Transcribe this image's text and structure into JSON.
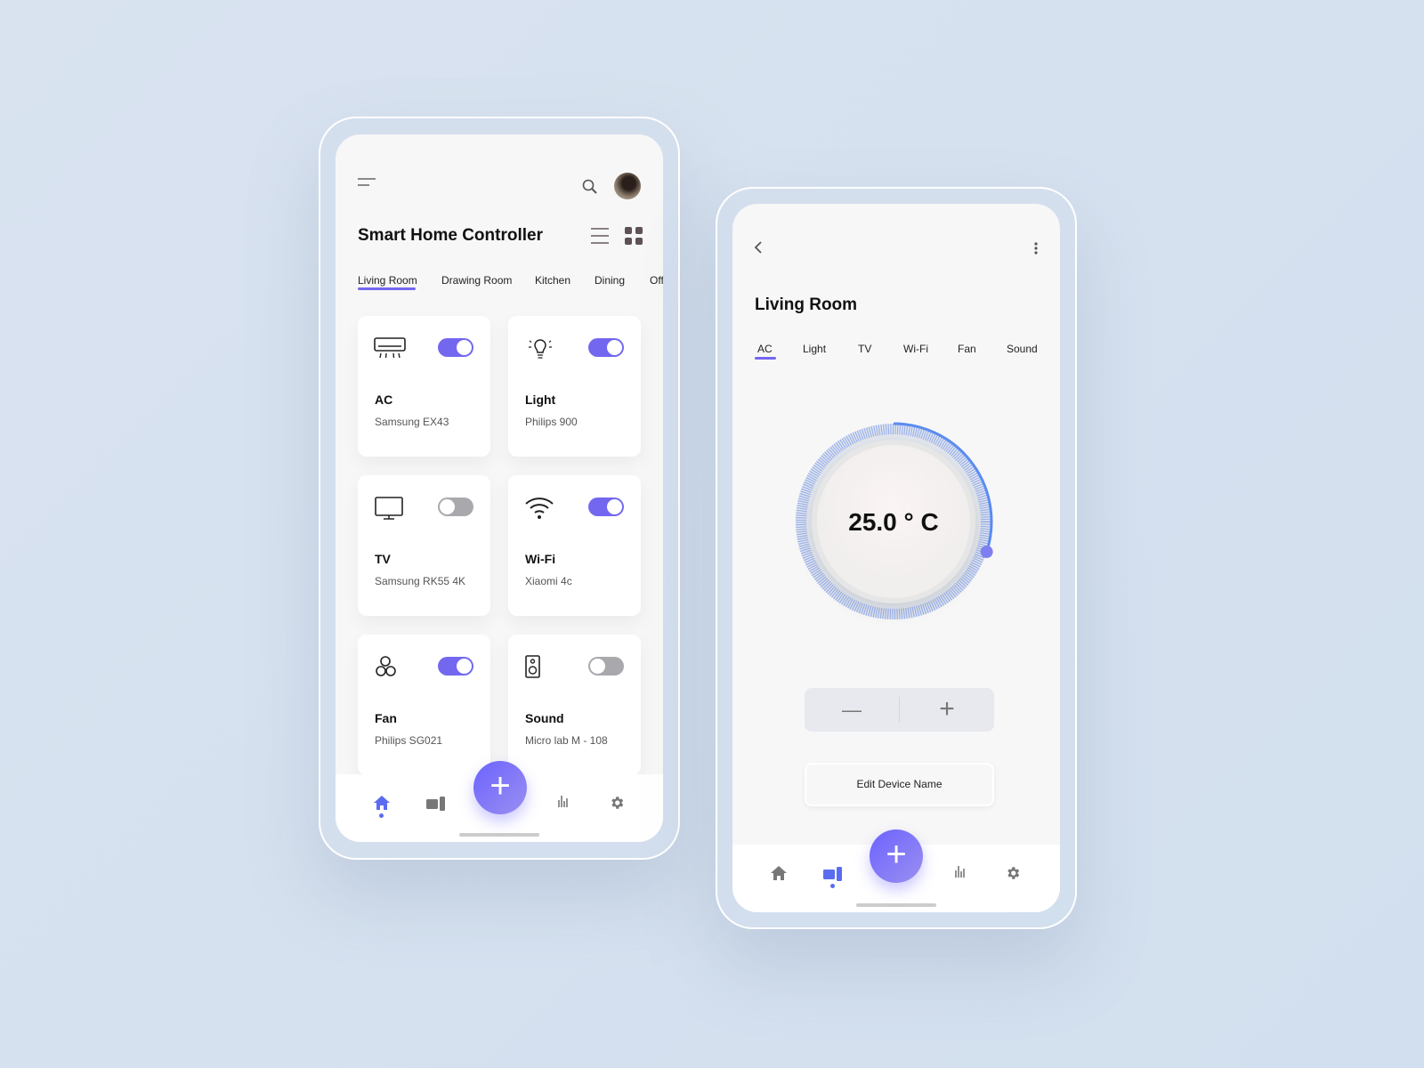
{
  "home": {
    "title": "Smart Home Controller",
    "tabs": [
      "Living Room",
      "Drawing Room",
      "Kitchen",
      "Dining",
      "Office"
    ],
    "active_tab": "Living Room",
    "devices": [
      {
        "name": "AC",
        "model": "Samsung EX43",
        "on": true,
        "icon": "ac-icon"
      },
      {
        "name": "Light",
        "model": "Philips 900",
        "on": true,
        "icon": "bulb-icon"
      },
      {
        "name": "TV",
        "model": "Samsung RK55 4K",
        "on": false,
        "icon": "tv-icon"
      },
      {
        "name": "Wi-Fi",
        "model": "Xiaomi 4c",
        "on": true,
        "icon": "wifi-icon"
      },
      {
        "name": "Fan",
        "model": "Philips SG021",
        "on": true,
        "icon": "fan-icon"
      },
      {
        "name": "Sound",
        "model": "Micro lab M - 108",
        "on": false,
        "icon": "speaker-icon"
      }
    ]
  },
  "detail": {
    "title": "Living Room",
    "tabs": [
      "AC",
      "Light",
      "TV",
      "Wi-Fi",
      "Fan",
      "Sound"
    ],
    "active_tab": "AC",
    "temperature": "25.0 ° C",
    "dial_level_percent": 30,
    "minus": "—",
    "plus": "+",
    "edit_label": "Edit Device Name"
  },
  "colors": {
    "accent": "#7367f0",
    "nav_active": "#5b6cf0",
    "background": "#d6e1ee"
  },
  "fab_label": "+"
}
